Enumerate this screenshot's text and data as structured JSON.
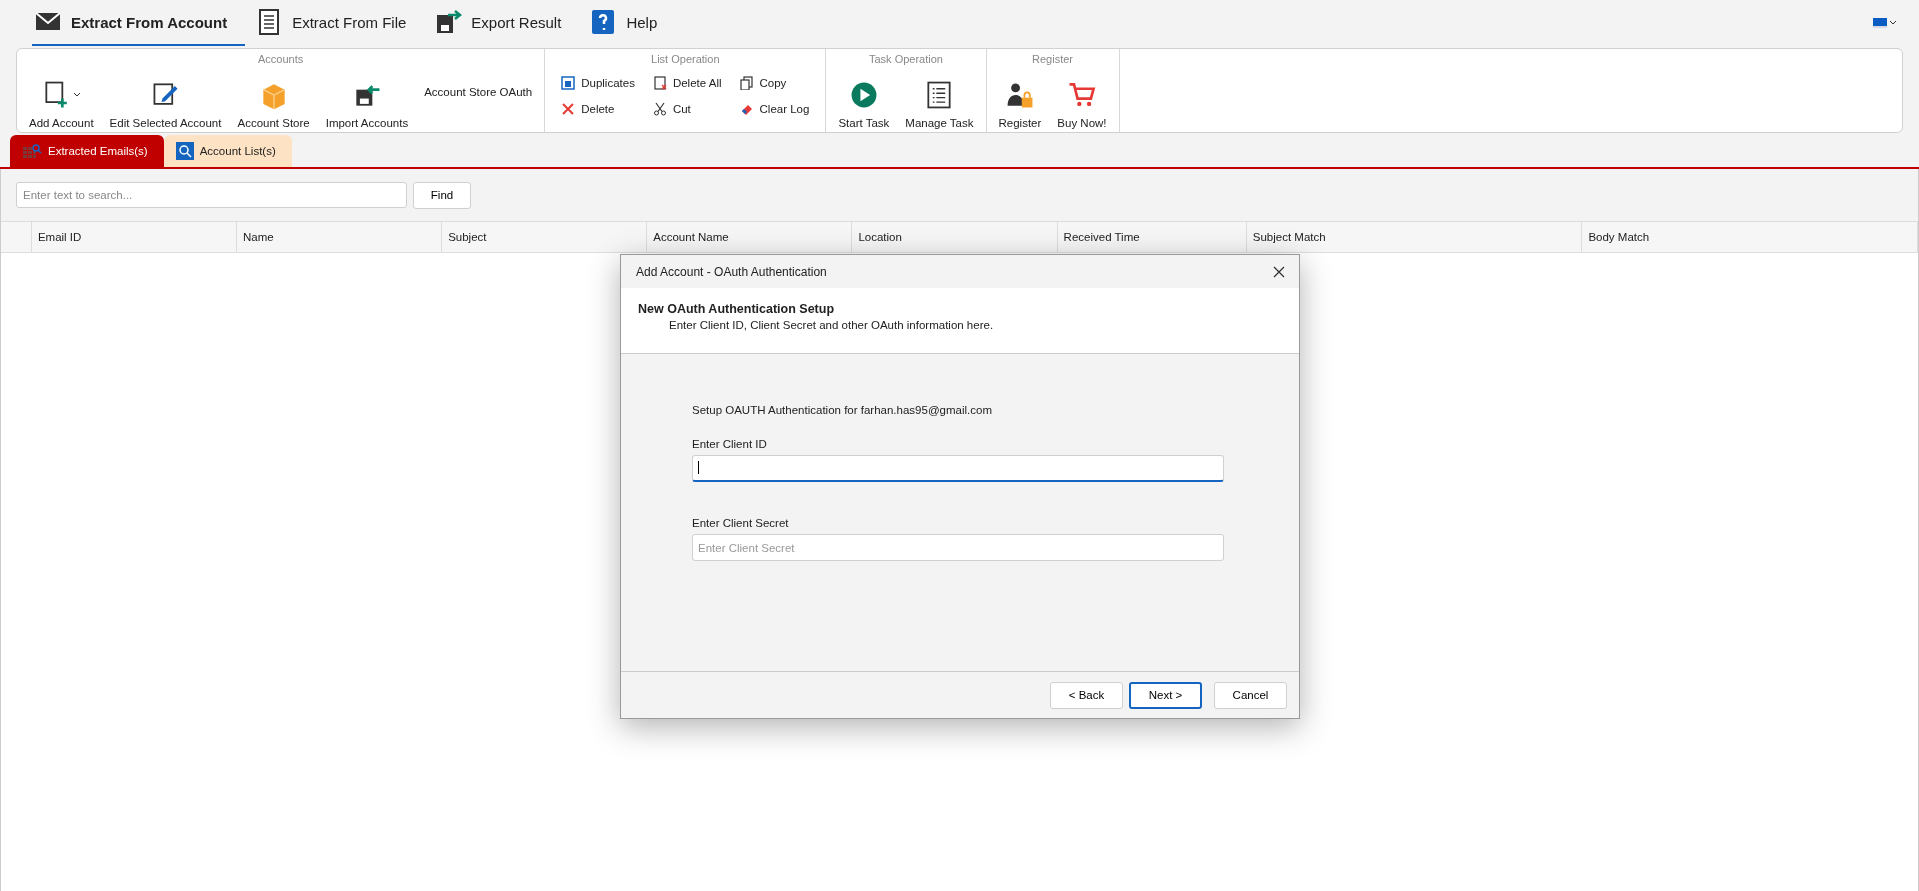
{
  "nav": [
    {
      "label": "Extract From Account",
      "kind": "mail",
      "selected": true
    },
    {
      "label": "Extract From File",
      "kind": "file",
      "selected": false
    },
    {
      "label": "Export Result",
      "kind": "export",
      "selected": false
    },
    {
      "label": "Help",
      "kind": "help",
      "selected": false
    }
  ],
  "ribbon": [
    {
      "title": "Accounts",
      "kind": "large",
      "items": [
        {
          "label": "Add Account",
          "kind": "add"
        },
        {
          "label": "Edit Selected Account",
          "kind": "edit"
        },
        {
          "label": "Account Store",
          "kind": "box"
        },
        {
          "label": "Import Accounts",
          "kind": "import"
        },
        {
          "label": "Account Store OAuth",
          "kind": "text"
        }
      ]
    },
    {
      "title": "List Operation",
      "kind": "small",
      "items": [
        {
          "label": "Duplicates",
          "kind": "duplicates"
        },
        {
          "label": "Delete All",
          "kind": "deleteall"
        },
        {
          "label": "Copy",
          "kind": "copy"
        },
        {
          "label": "Delete",
          "kind": "delete"
        },
        {
          "label": "Cut",
          "kind": "cut"
        },
        {
          "label": "Clear Log",
          "kind": "eraser"
        }
      ]
    },
    {
      "title": "Task Operation",
      "kind": "large",
      "items": [
        {
          "label": "Start Task",
          "kind": "play"
        },
        {
          "label": "Manage Task",
          "kind": "list"
        }
      ]
    },
    {
      "title": "Register",
      "kind": "large",
      "items": [
        {
          "label": "Register",
          "kind": "register"
        },
        {
          "label": "Buy Now!",
          "kind": "cart"
        }
      ]
    }
  ],
  "tabs": [
    {
      "label": "Extracted Emails(s)",
      "kind": "grid",
      "selected": true
    },
    {
      "label": "Account List(s)",
      "kind": "search",
      "selected": false
    }
  ],
  "search": {
    "placeholder": "Enter text to search...",
    "button": "Find"
  },
  "table": {
    "columns": [
      "Email ID",
      "Name",
      "Subject",
      "Account Name",
      "Location",
      "Received Time",
      "Subject Match",
      "Body Match"
    ]
  },
  "dialog": {
    "title": "Add Account - OAuth Authentication",
    "heading": "New OAuth Authentication Setup",
    "subheading": "Enter Client ID, Client Secret and other OAuth information here.",
    "intro": "Setup OAUTH Authentication for farhan.has95@gmail.com",
    "fields": [
      {
        "label": "Enter Client ID",
        "focused": true
      },
      {
        "label": "Enter Client Secret",
        "placeholder": "Enter Client Secret",
        "focused": false
      }
    ],
    "buttons": [
      {
        "label": "< Back",
        "default": false
      },
      {
        "label": "Next >",
        "default": true
      },
      {
        "label": "Cancel",
        "default": false
      }
    ]
  }
}
